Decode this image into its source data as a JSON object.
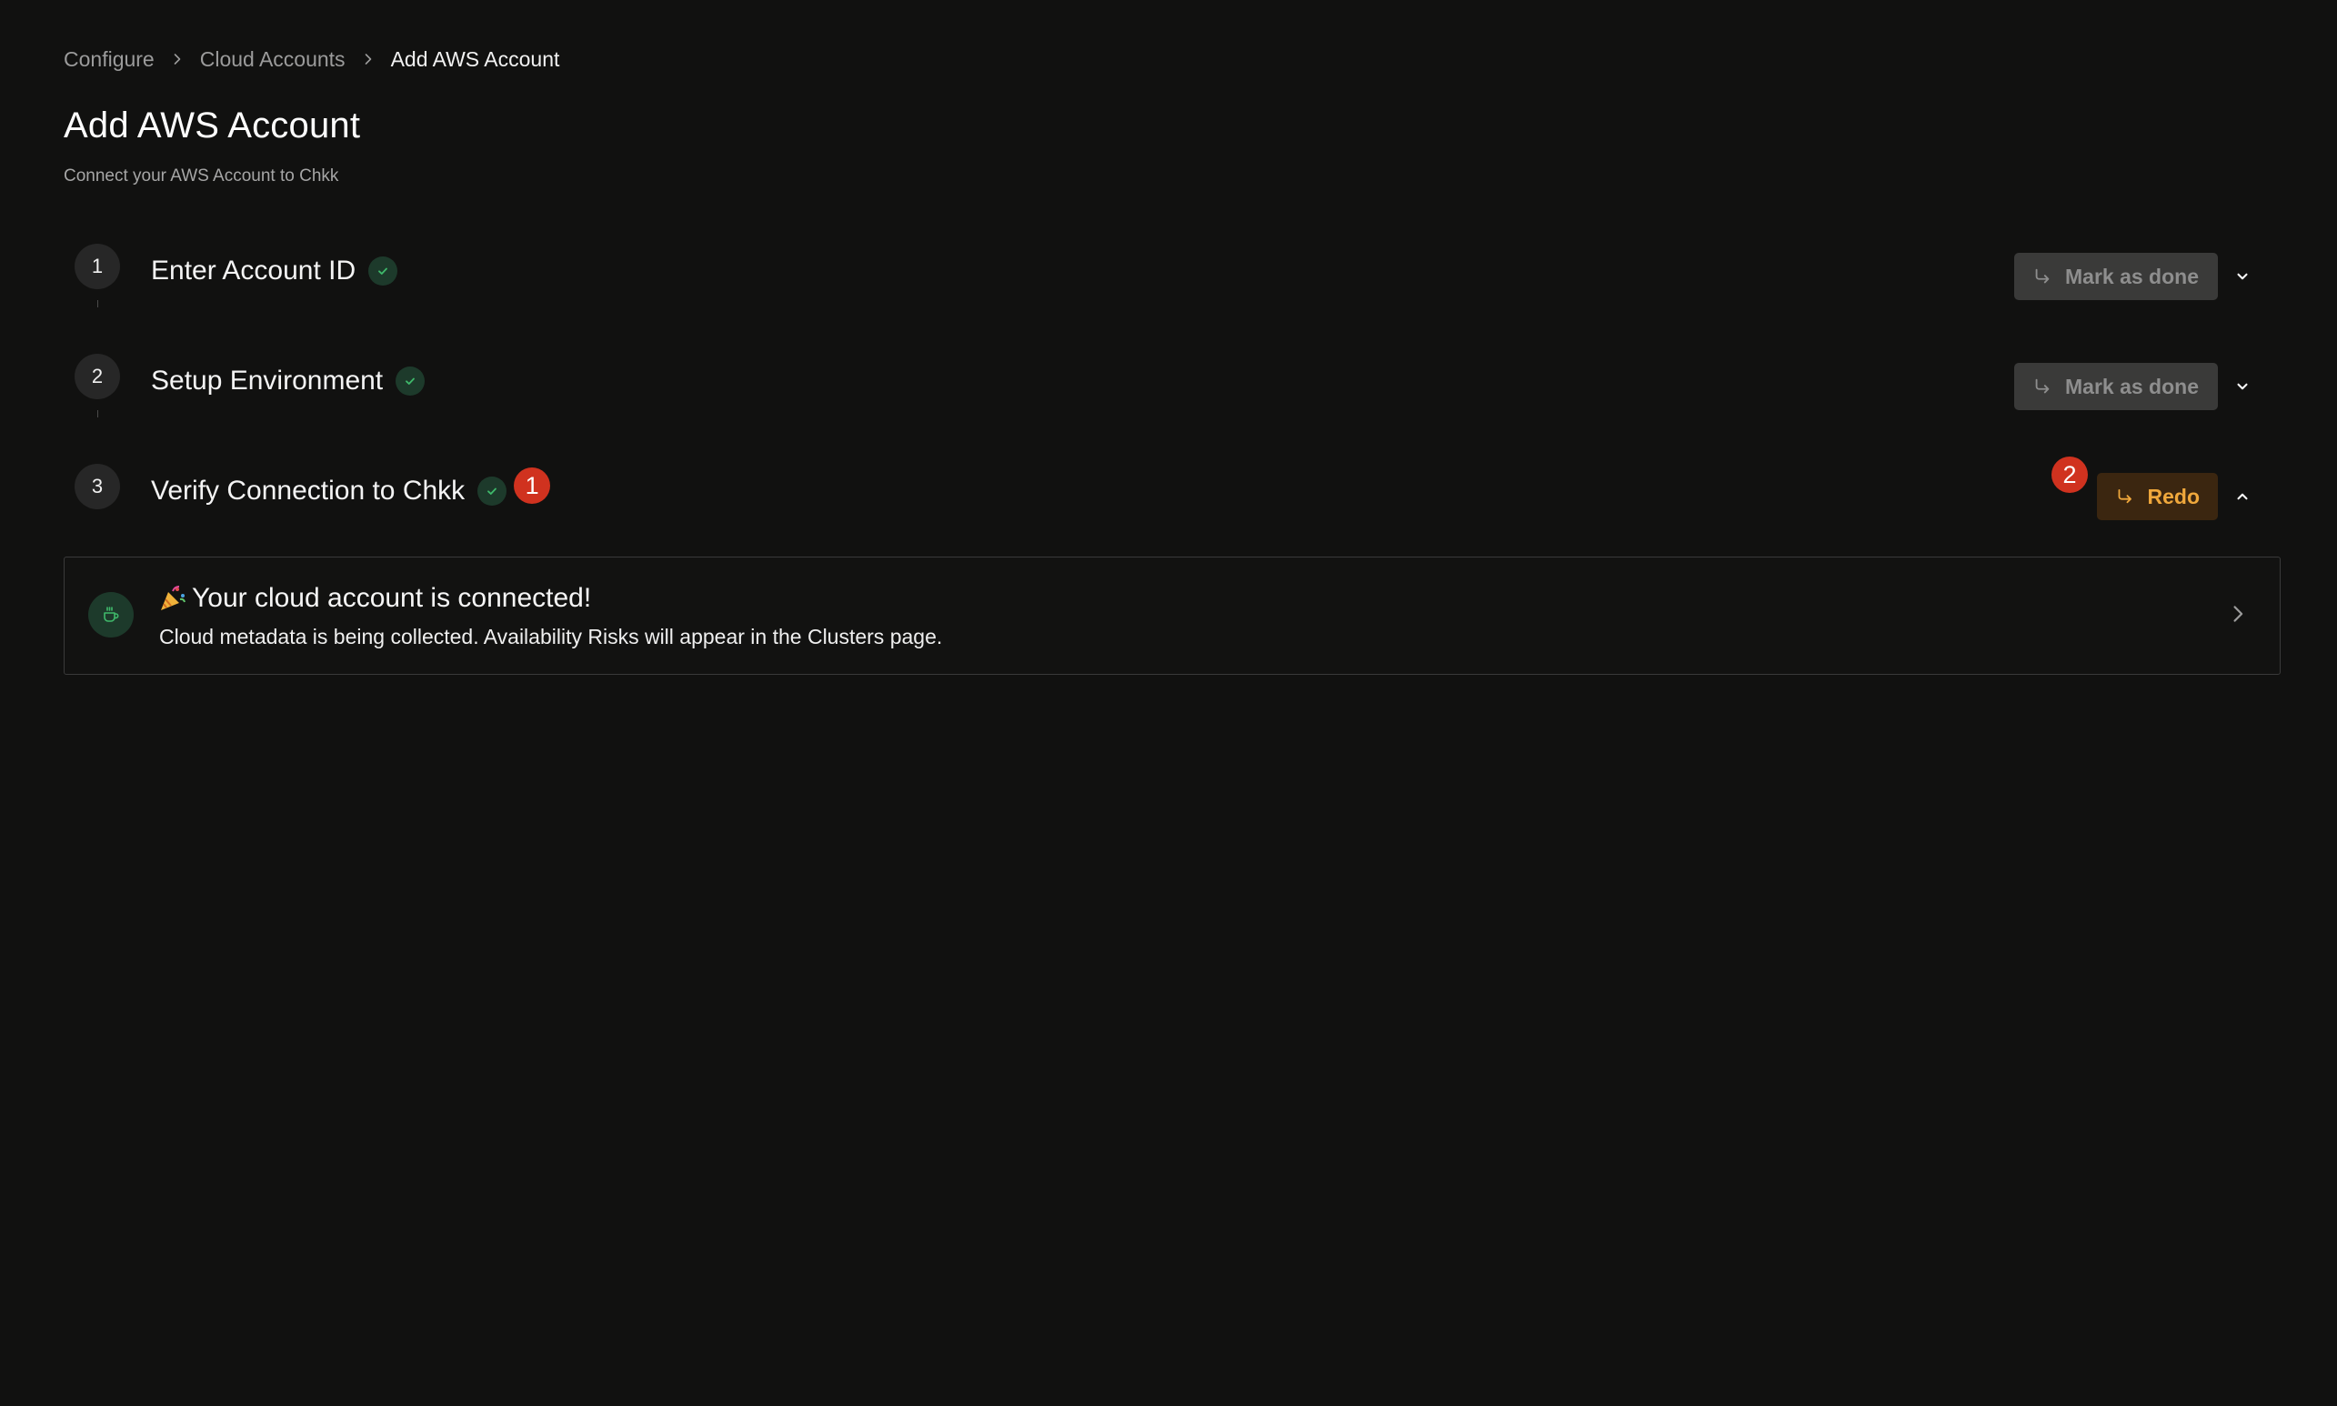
{
  "breadcrumb": {
    "items": [
      {
        "label": "Configure"
      },
      {
        "label": "Cloud Accounts"
      },
      {
        "label": "Add AWS Account"
      }
    ]
  },
  "header": {
    "title": "Add AWS Account",
    "subtitle": "Connect your AWS Account to Chkk"
  },
  "steps": [
    {
      "number": "1",
      "title": "Enter Account ID",
      "action_label": "Mark as done",
      "status": "complete"
    },
    {
      "number": "2",
      "title": "Setup Environment",
      "action_label": "Mark as done",
      "status": "complete"
    },
    {
      "number": "3",
      "title": "Verify Connection to Chkk",
      "action_label": "Redo",
      "status": "complete",
      "annotation": "1",
      "action_annotation": "2"
    }
  ],
  "success_card": {
    "title": "Your cloud account is connected!",
    "description": "Cloud metadata is being collected. Availability Risks will appear in the Clusters page.",
    "icon": "coffee-cup-icon",
    "emoji": "party-popper-icon"
  },
  "colors": {
    "background": "#111110",
    "success_green": "#3fb96b",
    "success_bg": "#1d3a2b",
    "redo_text": "#f0a83c",
    "redo_bg": "#3b2610",
    "annotation_red": "#d0321f"
  }
}
